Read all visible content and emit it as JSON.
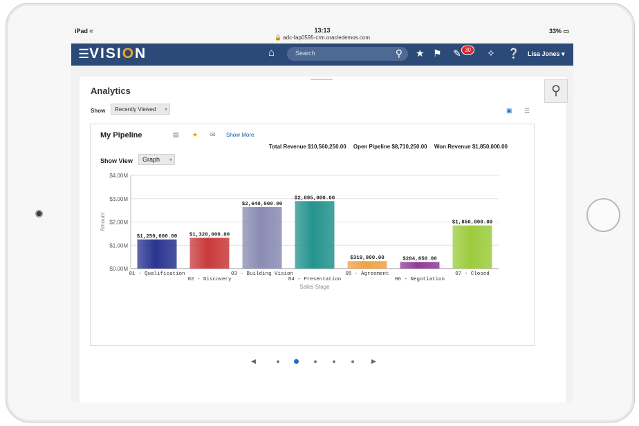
{
  "status": {
    "device": "iPad",
    "time": "13:13",
    "url": "adc-fap0595-crm.oracledemos.com",
    "battery": "33%"
  },
  "nav": {
    "logo_prefix": "VISI",
    "logo_o": "O",
    "logo_suffix": "N",
    "search_placeholder": "Search",
    "notifications": "30",
    "user": "Lisa Jones"
  },
  "page": {
    "title": "Analytics",
    "show_label": "Show",
    "show_value": "Recently Viewed"
  },
  "card": {
    "title": "My Pipeline",
    "show_more": "Show More",
    "total_revenue": "Total Revenue $10,560,250.00",
    "open_pipeline": "Open Pipeline $8,710,250.00",
    "won_revenue": "Won Revenue $1,850,000.00",
    "show_view_label": "Show View",
    "show_view_value": "Graph"
  },
  "chart_data": {
    "type": "bar",
    "categories": [
      "01 - Qualification",
      "02 - Discovery",
      "03 - Building Vision",
      "04 - Presentation",
      "05 - Agreement",
      "06 - Negotiation",
      "07 - Closed"
    ],
    "values": [
      1250600,
      1320000,
      2640000,
      2895000,
      319800,
      284850,
      1850000
    ],
    "labels": [
      "$1,250,600.00",
      "$1,320,000.00",
      "$2,640,000.00",
      "$2,895,000.00",
      "$319,800.00",
      "$284,850.00",
      "$1,850,000.00"
    ],
    "colors": [
      "#2a3590",
      "#c93a3c",
      "#8a8cb3",
      "#25938e",
      "#f0a244",
      "#8e3d95",
      "#9ccc3e"
    ],
    "xlabel": "Sales Stage",
    "ylabel": "Amount",
    "yticks": [
      "$0.00M",
      "$1.00M",
      "$2.00M",
      "$3.00M",
      "$4.00M"
    ],
    "ylim": [
      0,
      4000000
    ],
    "grid": true
  }
}
